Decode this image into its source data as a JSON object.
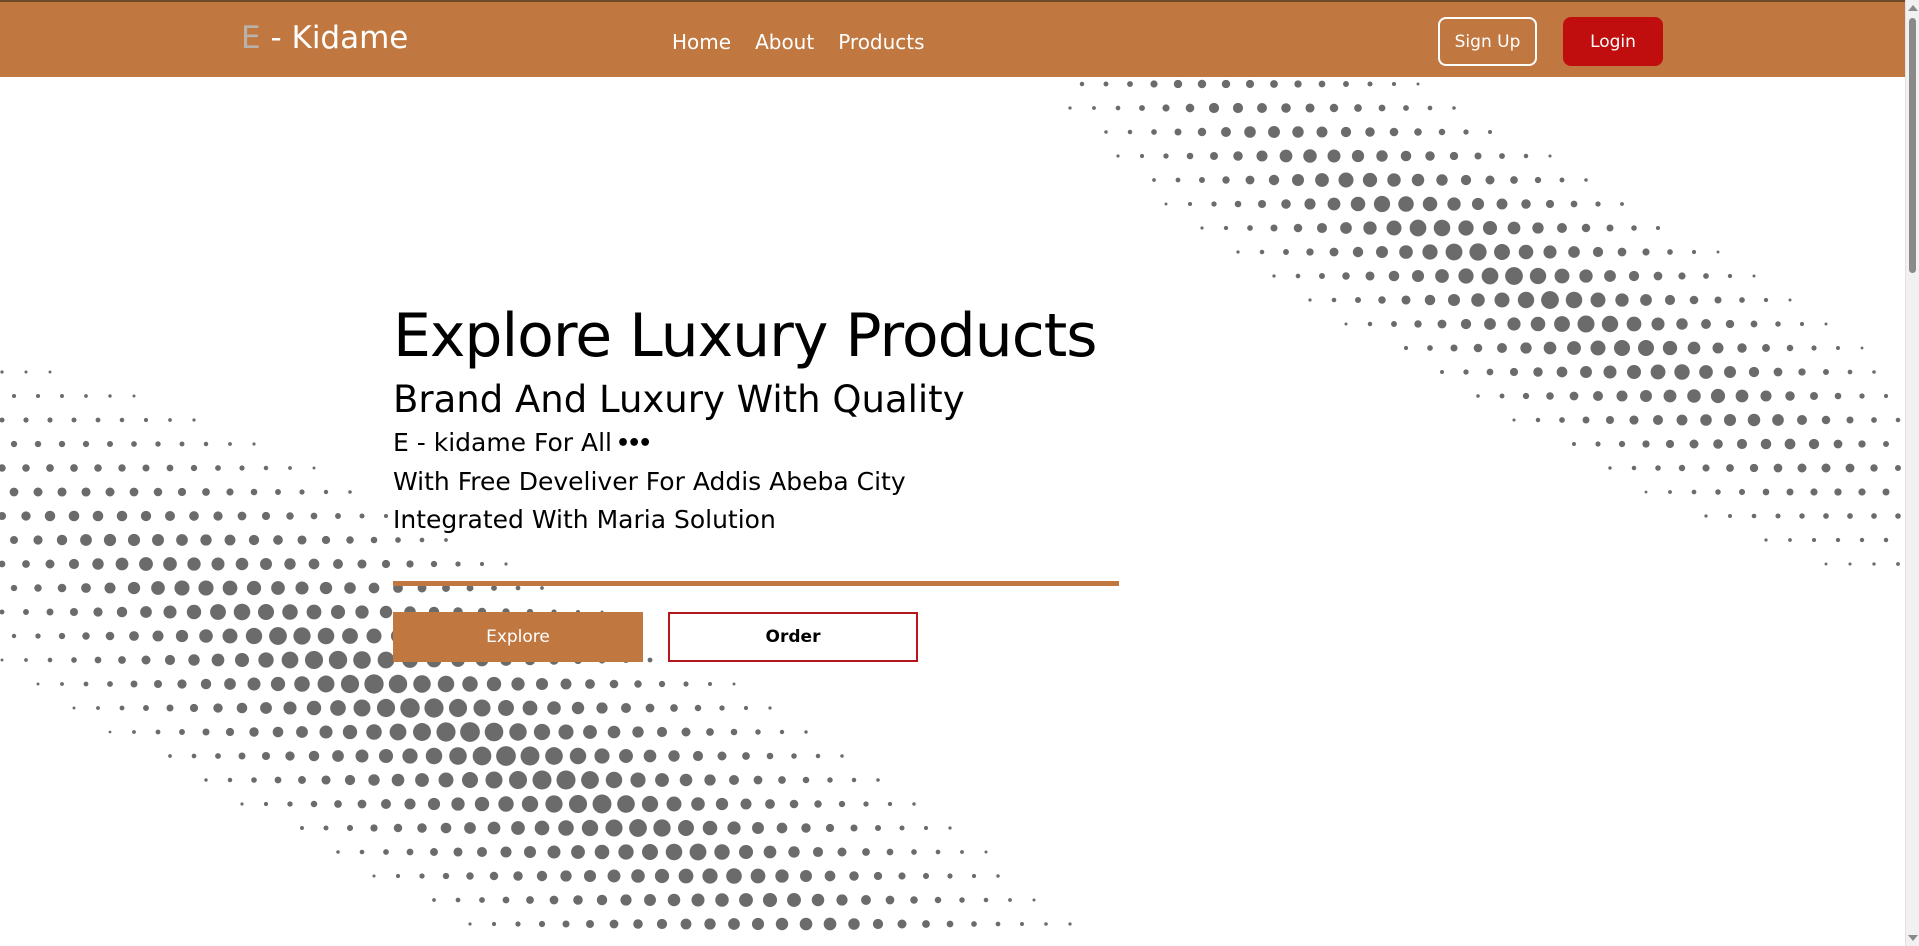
{
  "navbar": {
    "brand_letter": "E",
    "brand_rest": " - Kidame",
    "links": [
      "Home",
      "About",
      "Products"
    ],
    "signup_label": "Sign Up",
    "login_label": "Login"
  },
  "hero": {
    "title": "Explore Luxury Products",
    "subtitle": "Brand And Luxury With Quality",
    "line1": "E - kidame For All",
    "line2": "With Free Develiver For Addis Abeba City",
    "line3": "Integrated With Maria Solution",
    "explore_label": "Explore",
    "order_label": "Order"
  },
  "colors": {
    "brand": "#c07840",
    "login": "#c00d0d",
    "order_border": "#b3161b",
    "dots": "#6b6b6b"
  },
  "icons": {
    "more": "more-dots-icon",
    "halftone": "halftone-dots-decoration"
  }
}
